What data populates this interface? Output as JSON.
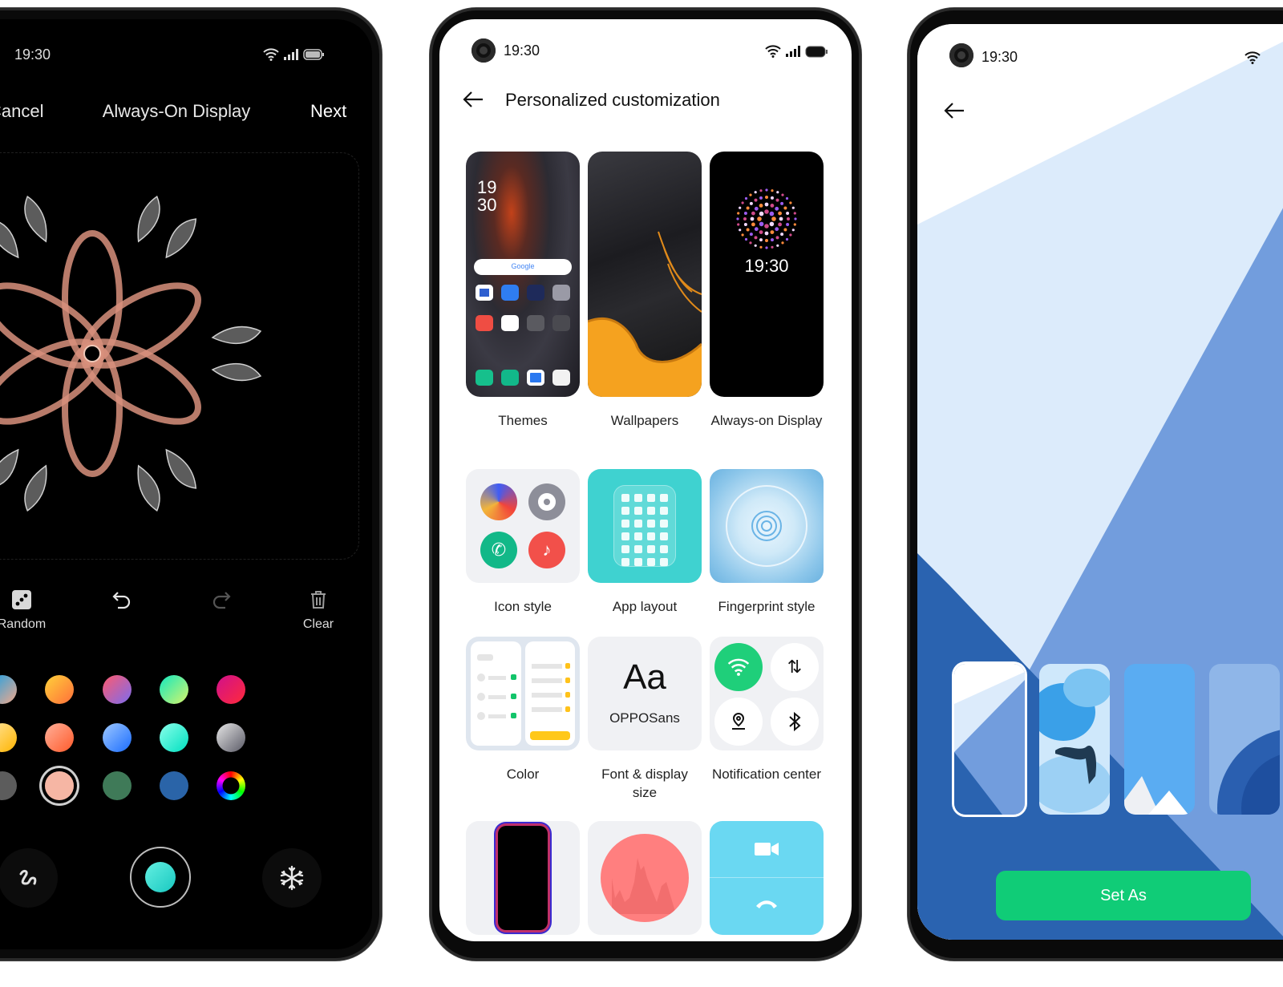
{
  "left_phone": {
    "status": {
      "time": "19:30",
      "icons": [
        "wifi-icon",
        "signal-icon",
        "battery-icon"
      ]
    },
    "header": {
      "cancel_label": "Cancel",
      "title": "Always-On Display",
      "next_label": "Next"
    },
    "toolbar": [
      {
        "icon": "dice-icon",
        "label": "Random"
      },
      {
        "icon": "undo-icon",
        "label": ""
      },
      {
        "icon": "redo-icon",
        "label": "",
        "disabled": true
      },
      {
        "icon": "trash-icon",
        "label": "Clear"
      }
    ],
    "palette": {
      "rows": [
        [
          {
            "name": "purple-red",
            "from": "#7a5cf0",
            "to": "#ff3b4e"
          },
          {
            "name": "blue-peach",
            "from": "#14a0e8",
            "to": "#f2a98a"
          },
          {
            "name": "yellow-orange",
            "from": "#ffd23a",
            "to": "#ff6e3a"
          },
          {
            "name": "red-violet",
            "from": "#ff5a6e",
            "to": "#7a6cf0"
          },
          {
            "name": "teal-lime",
            "from": "#11e8c0",
            "to": "#d8f56a"
          },
          {
            "name": "magenta-red",
            "from": "#d0108c",
            "to": "#ff2a3a"
          }
        ],
        [
          {
            "name": "pink-purple",
            "from": "#ff7ef0",
            "to": "#c030f0"
          },
          {
            "name": "cream-amber",
            "from": "#ffe6a0",
            "to": "#ffb400"
          },
          {
            "name": "salmon-orange",
            "from": "#ffb09a",
            "to": "#ff5a2a"
          },
          {
            "name": "sky-blue",
            "from": "#9ec8ff",
            "to": "#1a6cff"
          },
          {
            "name": "aqua",
            "from": "#8affea",
            "to": "#00e0c0"
          },
          {
            "name": "silver",
            "from": "#e6e6e6",
            "to": "#5a5a66"
          }
        ],
        [
          {
            "name": "white",
            "from": "#ffffff",
            "to": "#ffffff"
          },
          {
            "name": "gray",
            "from": "#5c5c5c",
            "to": "#5c5c5c"
          },
          {
            "name": "peach",
            "from": "#f6b6a4",
            "to": "#f6b6a4",
            "selected": true
          },
          {
            "name": "green",
            "from": "#3f7a58",
            "to": "#3f7a58"
          },
          {
            "name": "blue",
            "from": "#2a64a8",
            "to": "#2a64a8"
          },
          {
            "name": "custom-color-wheel",
            "wheel": true
          }
        ]
      ]
    },
    "bottom_controls": [
      {
        "icon": "squiggle-stroke-icon"
      },
      {
        "icon": "brush-color-icon",
        "color": "#22d6c8"
      },
      {
        "icon": "snowflake-symmetry-icon"
      }
    ]
  },
  "middle_phone": {
    "status": {
      "time": "19:30"
    },
    "header": {
      "title": "Personalized customization"
    },
    "items": [
      {
        "label": "Themes",
        "preview": {
          "clock_hour": "19",
          "clock_min": "30",
          "search": "Google"
        }
      },
      {
        "label": "Wallpapers"
      },
      {
        "label": "Always-on Display",
        "preview": {
          "clock": "19:30"
        }
      },
      {
        "label": "Icon style"
      },
      {
        "label": "App layout"
      },
      {
        "label": "Fingerprint style"
      },
      {
        "label": "Color"
      },
      {
        "label": "Font & display size",
        "preview": {
          "sample": "Aa",
          "font_name": "OPPOSans"
        }
      },
      {
        "label": "Notification center"
      },
      {
        "label": ""
      },
      {
        "label": ""
      },
      {
        "label": ""
      }
    ],
    "colors": {
      "accent_green": "#1fcf7a",
      "app_layout_teal": "#3fd2d0",
      "call_blue": "#6ad8f2",
      "ringtone_red": "#ff7f7f"
    }
  },
  "right_phone": {
    "status": {
      "time": "19:30"
    },
    "wallpapers": [
      {
        "name": "geometric-blue",
        "selected": true
      },
      {
        "name": "clouds"
      },
      {
        "name": "mountain-sky"
      },
      {
        "name": "abstract-circle"
      }
    ],
    "set_as_label": "Set As",
    "colors": {
      "button_green": "#10cc77",
      "light_blue": "#dcebfb",
      "mid_blue": "#729ddd",
      "dark_blue": "#2a63b0"
    }
  }
}
